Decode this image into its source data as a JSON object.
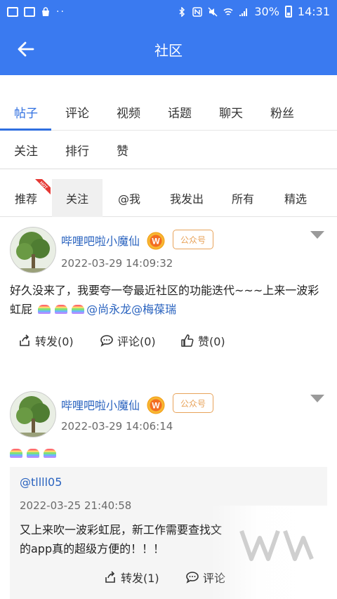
{
  "statusbar": {
    "battery": "30%",
    "time": "14:31"
  },
  "appbar": {
    "title": "社区"
  },
  "main_tabs": [
    "帖子",
    "评论",
    "视频",
    "话题",
    "聊天",
    "粉丝",
    "关注",
    "排行",
    "赞"
  ],
  "sub_tabs": [
    "推荐",
    "关注",
    "@我",
    "我发出",
    "所有",
    "精选"
  ],
  "hot_badge": "HOT",
  "posts": [
    {
      "username": "哔哩吧啦小魔仙",
      "badge": "W",
      "tag": "公众号",
      "time": "2022-03-29 14:09:32",
      "text": "好久没来了，我要夸一夸最近社区的功能迭代~~~上来一波彩虹屁",
      "mentions": "@尚永龙@梅葆瑞",
      "repost": "转发(0)",
      "comment": "评论(0)",
      "like": "赞(0)"
    },
    {
      "username": "哔哩吧啦小魔仙",
      "badge": "W",
      "tag": "公众号",
      "time": "2022-03-29 14:06:14",
      "quoted": {
        "user": "@tllll05",
        "time": "2022-03-25 21:40:58",
        "text_1": "又上来吹一波彩虹屁，新工作需要查找文",
        "text_2": "的app真的超级方便的！！！"
      },
      "repost": "转发(1)",
      "comment": "评论"
    }
  ]
}
